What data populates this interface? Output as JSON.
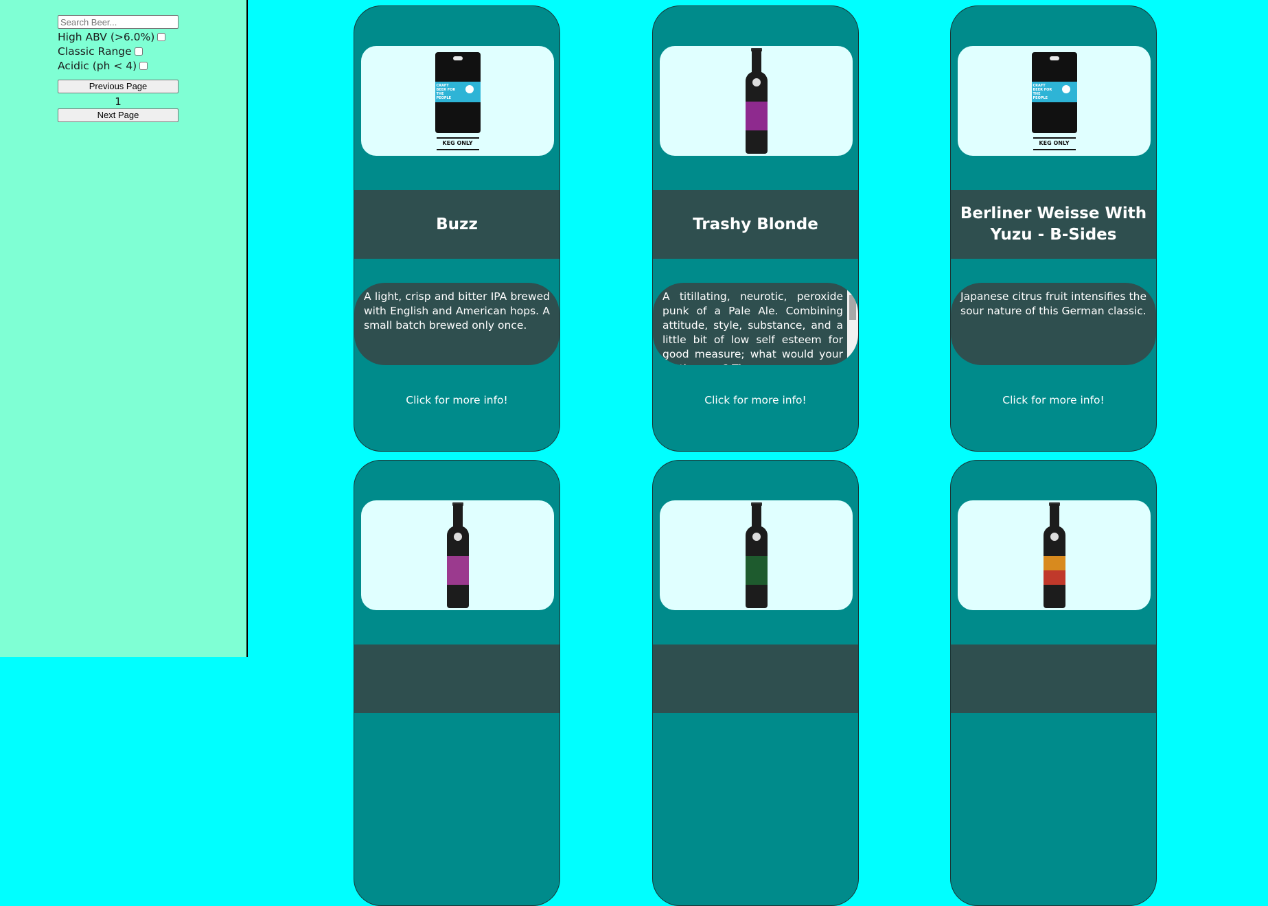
{
  "sidebar": {
    "search_placeholder": "Search Beer...",
    "filters": [
      {
        "label": "High ABV (>6.0%)",
        "checked": false
      },
      {
        "label": "Classic Range",
        "checked": false
      },
      {
        "label": "Acidic (ph < 4)",
        "checked": false
      }
    ],
    "previous_label": "Previous Page",
    "page_number": "1",
    "next_label": "Next Page"
  },
  "cards": [
    {
      "name": "Buzz",
      "image": "keg-only-icon",
      "description": "A light, crisp and bitter IPA brewed with English and American hops. A small batch brewed only once.",
      "more": "Click for more info!"
    },
    {
      "name": "Trashy Blonde",
      "image": "bottle-icon",
      "label_color": "#8e2a8e",
      "description": "A titillating, neurotic, peroxide punk of a Pale Ale. Combining attitude, style, substance, and a little bit of low self esteem for good measure; what would your mother say? The",
      "more": "Click for more info!"
    },
    {
      "name": "Berliner Weisse With Yuzu - B-Sides",
      "image": "keg-only-icon",
      "description": "Japanese citrus fruit intensifies the sour nature of this German classic.",
      "more": "Click for more info!"
    }
  ],
  "cards_row2": [
    {
      "image": "bottle-icon",
      "label_color": "#9b3a8e"
    },
    {
      "image": "bottle-icon",
      "label_color": "#1e5b2e"
    },
    {
      "image": "bottle-icon",
      "label_color": "#d88a1e"
    }
  ],
  "keg_art": {
    "label_text": "CRAFT BEER FOR THE PEOPLE",
    "caption": "KEG ONLY"
  },
  "colors": {
    "page_bg": "#00ffff",
    "sidebar_bg": "#7fffd4",
    "card_bg": "#008b8b",
    "band_bg": "#2f4f4f",
    "image_bg": "#e0ffff"
  }
}
